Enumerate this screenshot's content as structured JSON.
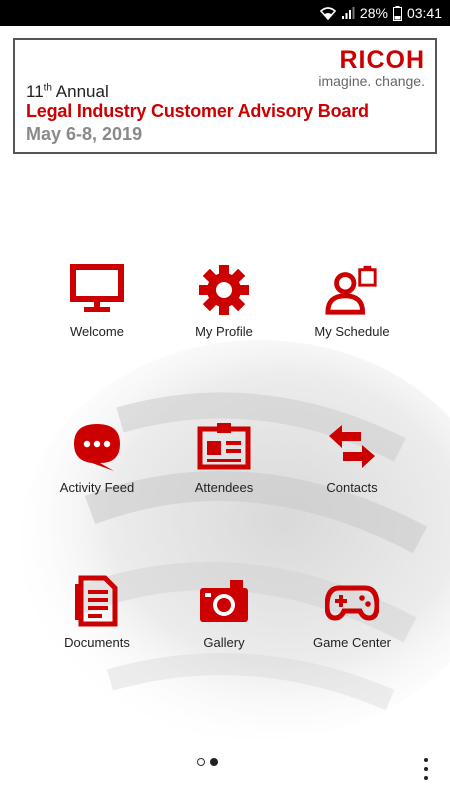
{
  "status_bar": {
    "battery": "28%",
    "time": "03:41"
  },
  "banner": {
    "edition_number": "11",
    "edition_suffix": "th",
    "edition_word": " Annual",
    "title": "Legal Industry Customer Advisory Board",
    "dates": "May 6-8, 2019",
    "logo_text": "RICOH",
    "logo_tagline": "imagine. change."
  },
  "grid": {
    "items": [
      {
        "label": "Welcome",
        "icon": "monitor-icon"
      },
      {
        "label": "My Profile",
        "icon": "gear-icon"
      },
      {
        "label": "My Schedule",
        "icon": "user-schedule-icon"
      },
      {
        "label": "Activity Feed",
        "icon": "chat-bubble-icon"
      },
      {
        "label": "Attendees",
        "icon": "id-badge-icon"
      },
      {
        "label": "Contacts",
        "icon": "swap-arrows-icon"
      },
      {
        "label": "Documents",
        "icon": "document-icon"
      },
      {
        "label": "Gallery",
        "icon": "camera-icon"
      },
      {
        "label": "Game Center",
        "icon": "gamepad-icon"
      }
    ]
  },
  "pager": {
    "current_page": 2,
    "total_pages": 2
  },
  "colors": {
    "accent": "#cc0000",
    "text": "#222222",
    "muted": "#8a8a8a"
  }
}
